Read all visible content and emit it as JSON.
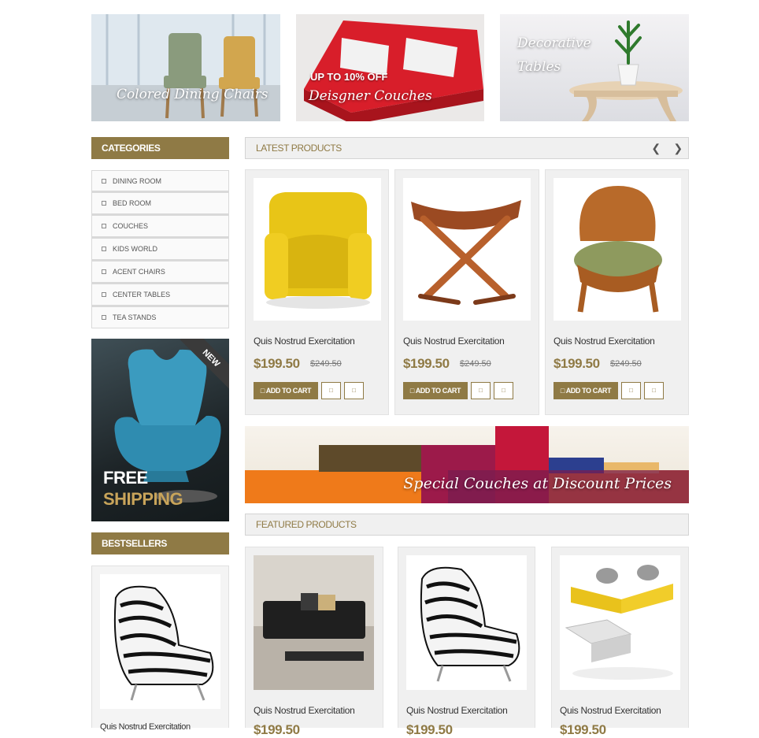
{
  "banners": {
    "dining": {
      "title": "Colored Dining Chairs"
    },
    "couches": {
      "promo": "UP TO 10% OFF",
      "title": "Deisgner Couches"
    },
    "tables": {
      "title": "Decorative Tables"
    }
  },
  "sidebar": {
    "categories_title": "CATEGORIES",
    "categories": [
      "DINING ROOM",
      "BED ROOM",
      "COUCHES",
      "KIDS WORLD",
      "ACENT CHAIRS",
      "CENTER TABLES",
      "TEA STANDS"
    ],
    "shipping": {
      "line1": "FREE",
      "line2": "SHIPPING",
      "ribbon": "NEW"
    },
    "bestsellers_title": "BESTSELLERS",
    "bestseller": {
      "name": "Quis Nostrud Exercitation"
    }
  },
  "latest": {
    "title": "LATEST PRODUCTS",
    "prev_icon": "chevron-left-icon",
    "next_icon": "chevron-right-icon",
    "products": [
      {
        "name": "Quis Nostrud Exercitation",
        "price": "$199.50",
        "old_price": "$249.50",
        "cart": "ADD TO CART",
        "image": "yellow-armchair"
      },
      {
        "name": "Quis Nostrud Exercitation",
        "price": "$199.50",
        "old_price": "$249.50",
        "cart": "ADD TO CART",
        "image": "folding-stool"
      },
      {
        "name": "Quis Nostrud Exercitation",
        "price": "$199.50",
        "old_price": "$249.50",
        "cart": "ADD TO CART",
        "image": "carved-chair"
      }
    ]
  },
  "promo_banner": {
    "text": "Special Couches at Discount Prices"
  },
  "featured": {
    "title": "FEATURED PRODUCTS",
    "products": [
      {
        "name": "Quis Nostrud Exercitation",
        "price": "$199.50",
        "image": "black-sofa"
      },
      {
        "name": "Quis Nostrud Exercitation",
        "price": "$199.50",
        "image": "zebra-chair"
      },
      {
        "name": "Quis Nostrud Exercitation",
        "price": "$199.50",
        "image": "yellow-sofa"
      }
    ]
  },
  "colors": {
    "accent": "#8f7a45",
    "panel": "#f0f0f0"
  }
}
